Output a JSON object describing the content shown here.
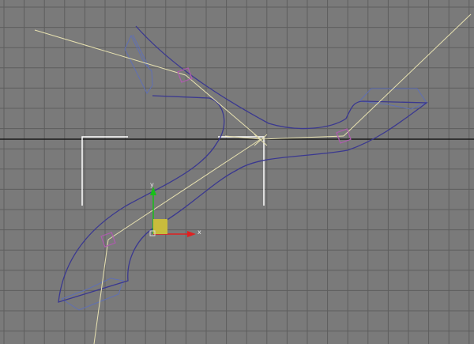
{
  "viewport": {
    "background": "#7a7a7a",
    "grid_color": "#5e5e5e",
    "grid_count_x": 23,
    "grid_count_y": 17,
    "horizon_color": "#1a1a1a"
  },
  "colors": {
    "spline": "#3a3890",
    "helper_outline": "#5f6fb5",
    "trajectory": "#e7e1b0",
    "camera_bracket": "#ffffff",
    "vertex_handle": "#b05ab0",
    "gizmo_x_axis": "#e02020",
    "gizmo_y_axis": "#18c018",
    "gizmo_plane": "#c8bc3c"
  },
  "gizmo": {
    "x_label": "x",
    "y_label": "y"
  }
}
